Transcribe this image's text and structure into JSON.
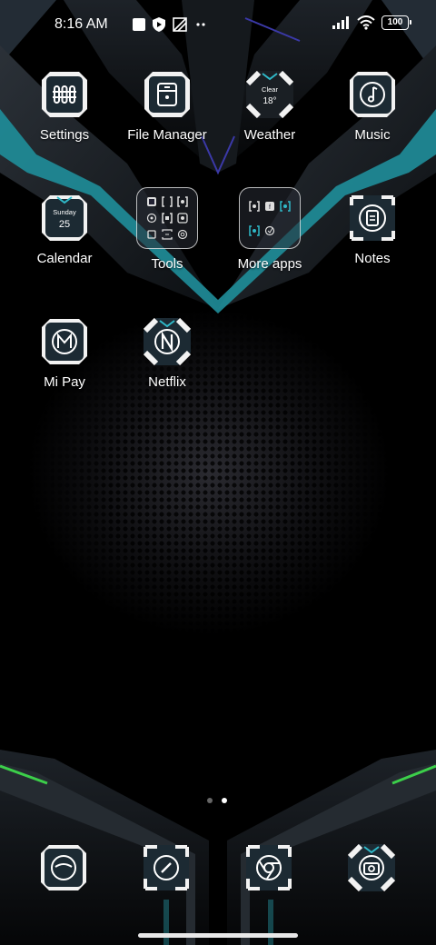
{
  "status_bar": {
    "time": "8:16 AM",
    "left_icons": [
      "gallery-icon",
      "play-protect-icon",
      "app-notification-icon",
      "more-dots-icon"
    ],
    "right_icons": [
      "signal-icon",
      "wifi-icon",
      "battery-icon"
    ],
    "battery": "100"
  },
  "home": {
    "apps": [
      {
        "label": "Settings",
        "icon": "settings-icon"
      },
      {
        "label": "File Manager",
        "icon": "file-manager-icon"
      },
      {
        "label": "Weather",
        "icon": "weather-icon",
        "condition": "Clear",
        "temp": "18°"
      },
      {
        "label": "Music",
        "icon": "music-icon"
      },
      {
        "label": "Calendar",
        "icon": "calendar-icon",
        "day": "Sunday",
        "date": "25"
      },
      {
        "label": "Tools",
        "icon": "folder-icon"
      },
      {
        "label": "More apps",
        "icon": "folder-icon"
      },
      {
        "label": "Notes",
        "icon": "notes-icon"
      },
      {
        "label": "Mi Pay",
        "icon": "mi-pay-icon"
      },
      {
        "label": "Netflix",
        "icon": "netflix-icon"
      }
    ]
  },
  "page_indicator": {
    "count": 2,
    "active": 2
  },
  "dock": [
    {
      "icon": "messages-icon"
    },
    {
      "icon": "compass-icon"
    },
    {
      "icon": "chrome-icon"
    },
    {
      "icon": "camera-icon"
    }
  ],
  "colors": {
    "accent": "#2fb9c8",
    "green_light": "#3ccf4a",
    "icon_frame": "#f2f2f2",
    "icon_bg": "#1c2a33"
  }
}
